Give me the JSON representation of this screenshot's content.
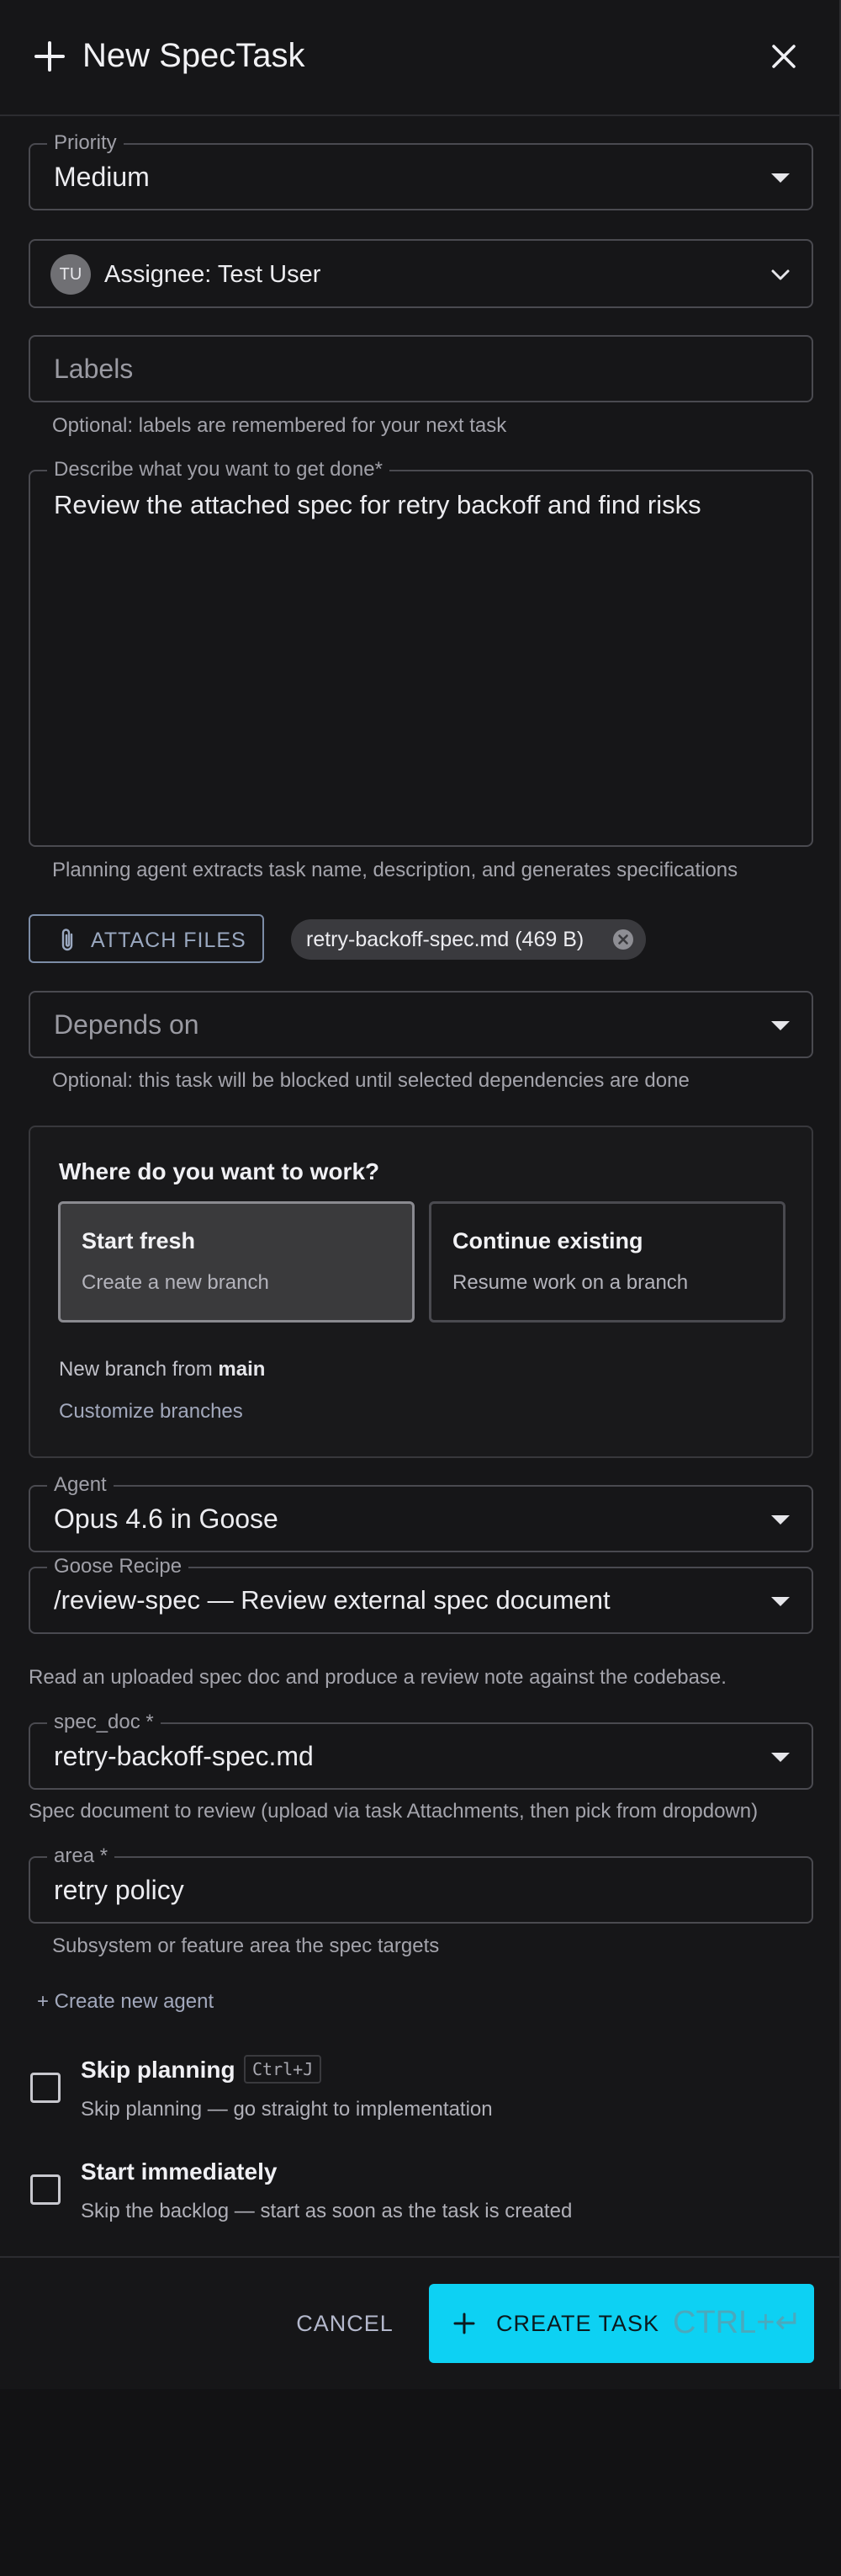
{
  "header": {
    "title": "New SpecTask"
  },
  "priority": {
    "label": "Priority",
    "value": "Medium"
  },
  "assignee": {
    "initials": "TU",
    "value": "Assignee: Test User"
  },
  "labels": {
    "placeholder": "Labels",
    "helper": "Optional: labels are remembered for your next task"
  },
  "description": {
    "label": "Describe what you want to get done",
    "required_mark": "*",
    "value": "Review the attached spec for retry backoff and find risks",
    "helper": "Planning agent extracts task name, description, and generates specifications"
  },
  "attachments": {
    "button_label": "ATTACH FILES",
    "files": [
      {
        "label": "retry-backoff-spec.md (469 B)"
      }
    ]
  },
  "depends_on": {
    "placeholder": "Depends on",
    "helper": "Optional: this task will be blocked until selected dependencies are done"
  },
  "workspace": {
    "title": "Where do you want to work?",
    "options": [
      {
        "title": "Start fresh",
        "subtitle": "Create a new branch",
        "selected": true
      },
      {
        "title": "Continue existing",
        "subtitle": "Resume work on a branch",
        "selected": false
      }
    ],
    "branch_prefix": "New branch from ",
    "branch_name": "main",
    "customize_label": "Customize branches"
  },
  "agent": {
    "label": "Agent",
    "value": "Opus 4.6 in Goose"
  },
  "recipe": {
    "label": "Goose Recipe",
    "value": "/review-spec — Review external spec document",
    "description": "Read an uploaded spec doc and produce a review note against the codebase."
  },
  "spec_doc": {
    "label": "spec_doc",
    "required_mark": "*",
    "value": "retry-backoff-spec.md",
    "helper": "Spec document to review (upload via task Attachments, then pick from dropdown)"
  },
  "area": {
    "label": "area",
    "required_mark": "*",
    "value": "retry policy",
    "helper": "Subsystem or feature area the spec targets"
  },
  "create_agent_label": "+ Create new agent",
  "skip_planning": {
    "title": "Skip planning",
    "shortcut": "Ctrl+J",
    "subtitle": "Skip planning — go straight to implementation",
    "checked": false
  },
  "start_immediately": {
    "title": "Start immediately",
    "subtitle": "Skip the backlog — start as soon as the task is created",
    "checked": false
  },
  "footer": {
    "cancel_label": "CANCEL",
    "create_label": "CREATE TASK",
    "create_shortcut": "CTRL+↵",
    "accent_color": "#0dd1f3"
  }
}
